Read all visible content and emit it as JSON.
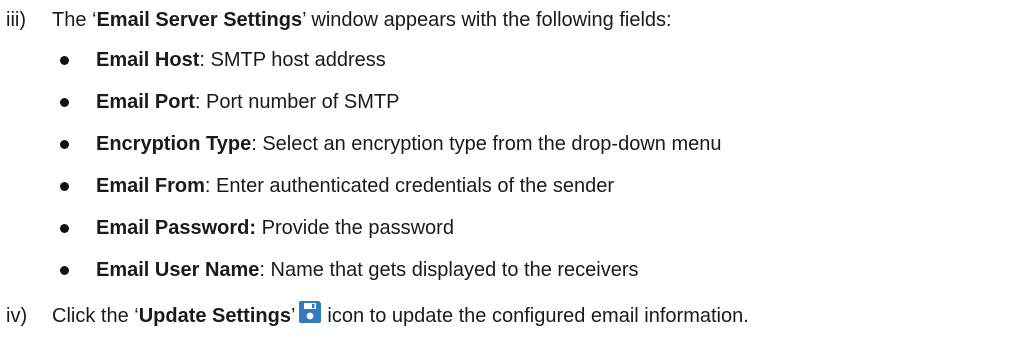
{
  "steps": {
    "iii": {
      "num": "iii)",
      "pre": "The ‘",
      "bold": "Email Server Settings",
      "post": "’ window appears with the following fields:"
    },
    "iv": {
      "num": "iv)",
      "pre": "Click the ‘",
      "bold": "Update Settings",
      "mid": "’",
      "icon": "save-icon",
      "post": "icon to update the configured email information."
    }
  },
  "fields": [
    {
      "label": "Email Host",
      "sep": ": ",
      "desc": "SMTP host address"
    },
    {
      "label": "Email Port",
      "sep": ": ",
      "desc": "Port number of SMTP"
    },
    {
      "label": "Encryption Type",
      "sep": ": ",
      "desc": "Select an encryption type from the drop-down menu"
    },
    {
      "label": "Email From",
      "sep": ": ",
      "desc": "Enter authenticated credentials of the sender"
    },
    {
      "label": "Email Password:",
      "sep": " ",
      "desc": "Provide the password"
    },
    {
      "label": "Email User Name",
      "sep": ": ",
      "desc": "Name that gets displayed to the receivers"
    }
  ],
  "colors": {
    "save_icon": "#2e7bbf"
  }
}
